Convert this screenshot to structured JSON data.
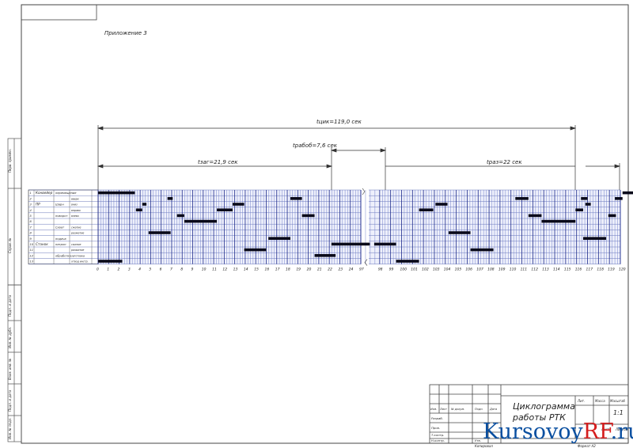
{
  "appendix_label": "Приложение 3",
  "dimensions": {
    "total": "tцик=119,0 сек",
    "transfer": "tрабоб=7,6 сек",
    "left": "tзаг=21,9 сек",
    "right": "tраз=22 сек"
  },
  "rows": [
    {
      "num": "1",
      "group": "Конвейер",
      "name": "перемещение",
      "dir": ""
    },
    {
      "num": "2",
      "group": "",
      "name": "",
      "dir": "вверх"
    },
    {
      "num": "3",
      "group": "ПР",
      "name": "Шарн",
      "dir": "вниз"
    },
    {
      "num": "4",
      "group": "",
      "name": "",
      "dir": "вправо"
    },
    {
      "num": "5",
      "group": "",
      "name": "поворот",
      "dir": "влево"
    },
    {
      "num": "6",
      "group": "",
      "name": "",
      "dir": ""
    },
    {
      "num": "7",
      "group": "",
      "name": "Схват",
      "dir": "сжатие"
    },
    {
      "num": "8",
      "group": "",
      "name": "",
      "dir": "разжатие"
    },
    {
      "num": "9",
      "group": "",
      "name": "подача",
      "dir": ""
    },
    {
      "num": "10",
      "group": "Станок",
      "name": "патрон",
      "dir": "сжатие"
    },
    {
      "num": "11",
      "group": "",
      "name": "",
      "dir": "разжатие"
    },
    {
      "num": "12",
      "group": "",
      "name": "обработка",
      "dir": "заготовка"
    },
    {
      "num": "13",
      "group": "",
      "name": "",
      "dir": "отвод инстр."
    }
  ],
  "axis_labels": [
    "0",
    "1",
    "2",
    "3",
    "4",
    "5",
    "6",
    "7",
    "8",
    "9",
    "10",
    "11",
    "12",
    "13",
    "14",
    "15",
    "16",
    "17",
    "18",
    "19",
    "20",
    "21",
    "22",
    "23",
    "24",
    "97",
    "98",
    "99",
    "100",
    "101",
    "102",
    "103",
    "104",
    "105",
    "106",
    "107",
    "108",
    "109",
    "110",
    "111",
    "112",
    "113",
    "114",
    "115",
    "116",
    "117",
    "118",
    "119",
    "120"
  ],
  "segments": [
    {
      "row": 0,
      "from": 0,
      "to": 3.5
    },
    {
      "row": 0,
      "from": 48.2,
      "to": 52
    },
    {
      "row": 1,
      "from": 6.6,
      "to": 7.1
    },
    {
      "row": 1,
      "from": 18.3,
      "to": 19.4
    },
    {
      "row": 1,
      "from": 38.4,
      "to": 39.6
    },
    {
      "row": 1,
      "from": 44.4,
      "to": 45.0
    },
    {
      "row": 1,
      "from": 47.5,
      "to": 48.2
    },
    {
      "row": 2,
      "from": 4.2,
      "to": 4.6
    },
    {
      "row": 2,
      "from": 12.8,
      "to": 13.9
    },
    {
      "row": 2,
      "from": 31.1,
      "to": 32.2
    },
    {
      "row": 2,
      "from": 44.8,
      "to": 45.3
    },
    {
      "row": 3,
      "from": 3.6,
      "to": 4.2
    },
    {
      "row": 3,
      "from": 11.3,
      "to": 12.8
    },
    {
      "row": 3,
      "from": 29.6,
      "to": 30.9
    },
    {
      "row": 3,
      "from": 43.9,
      "to": 44.6
    },
    {
      "row": 4,
      "from": 7.5,
      "to": 8.2
    },
    {
      "row": 4,
      "from": 19.4,
      "to": 20.6
    },
    {
      "row": 4,
      "from": 39.6,
      "to": 40.8
    },
    {
      "row": 4,
      "from": 46.9,
      "to": 47.6
    },
    {
      "row": 5,
      "from": 8.2,
      "to": 11.3
    },
    {
      "row": 5,
      "from": 40.8,
      "to": 43.9
    },
    {
      "row": 7,
      "from": 4.8,
      "to": 6.9
    },
    {
      "row": 7,
      "from": 32.3,
      "to": 34.3
    },
    {
      "row": 8,
      "from": 16.2,
      "to": 18.3
    },
    {
      "row": 8,
      "from": 44.6,
      "to": 46.7
    },
    {
      "row": 9,
      "from": 22.2,
      "to": 25.1
    },
    {
      "row": 9,
      "from": 25.5,
      "to": 27.5
    },
    {
      "row": 10,
      "from": 13.9,
      "to": 16.0
    },
    {
      "row": 10,
      "from": 34.3,
      "to": 36.4
    },
    {
      "row": 11,
      "from": 20.6,
      "to": 22.6
    },
    {
      "row": 12,
      "from": 0,
      "to": 2.3
    },
    {
      "row": 12,
      "from": 27.5,
      "to": 29.6
    }
  ],
  "title_block": {
    "title_line1": "Циклограмма",
    "title_line2": "работы РТК",
    "lit_label": "Лит.",
    "mass_label": "Масса",
    "scale_label": "Масштаб",
    "scale_value": "1:1",
    "sheet_label": "Лист",
    "sheets_label": "Листов",
    "izm": "Изм.",
    "list": "Лист",
    "doc_no": "№ докум.",
    "sign": "Подп.",
    "date": "Дата",
    "razrab": "Разраб.",
    "prov": "Пров.",
    "tkontr": "Т.контр.",
    "nkontr": "Н.контр.",
    "utv": "Утв.",
    "copied": "Копировал",
    "format": "Формат  А2"
  },
  "side_labels": [
    "Перв. примен.",
    "Справ. №",
    "Подп. и дата",
    "Инв. № дубл.",
    "Взам. инв. №",
    "Подп. и дата",
    "Инв. № подл."
  ],
  "watermark": {
    "part1": "Kursovoy",
    "part2": "RF",
    "part3": ".ru"
  }
}
